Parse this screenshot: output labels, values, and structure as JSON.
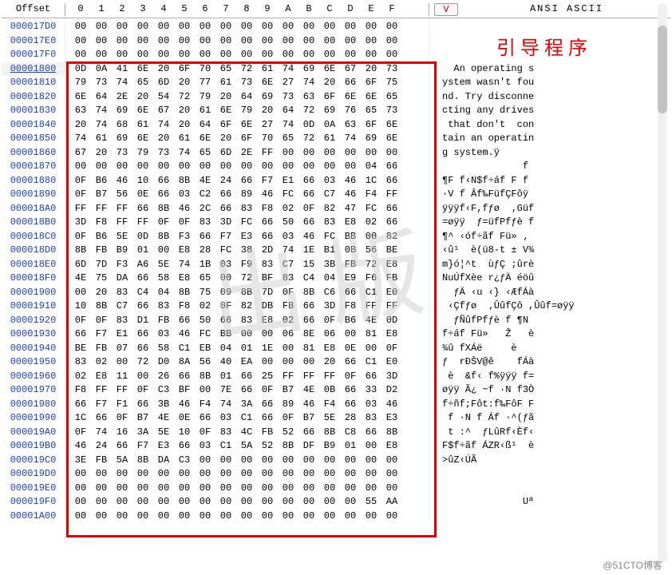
{
  "header": {
    "offset_label": "Offset",
    "hex_cols": [
      "0",
      "1",
      "2",
      "3",
      "4",
      "5",
      "6",
      "7",
      "8",
      "9",
      "A",
      "B",
      "C",
      "D",
      "E",
      "F"
    ],
    "v_button": "V",
    "ascii_label": "ANSI ASCII"
  },
  "annotation": "引导程序",
  "watermark_cn": "出版",
  "watermark_br": "@51CTO博客",
  "selected_offset": "00001800",
  "rows": [
    {
      "offset": "000017D0",
      "hex": [
        "00",
        "00",
        "00",
        "00",
        "00",
        "00",
        "00",
        "00",
        "00",
        "00",
        "00",
        "00",
        "00",
        "00",
        "00",
        "00"
      ],
      "ascii": ""
    },
    {
      "offset": "000017E0",
      "hex": [
        "00",
        "00",
        "00",
        "00",
        "00",
        "00",
        "00",
        "00",
        "00",
        "00",
        "00",
        "00",
        "00",
        "00",
        "00",
        "00"
      ],
      "ascii": ""
    },
    {
      "offset": "000017F0",
      "hex": [
        "00",
        "00",
        "00",
        "00",
        "00",
        "00",
        "00",
        "00",
        "00",
        "00",
        "00",
        "00",
        "00",
        "00",
        "00",
        "00"
      ],
      "ascii": ""
    },
    {
      "offset": "00001800",
      "hex": [
        "0D",
        "0A",
        "41",
        "6E",
        "20",
        "6F",
        "70",
        "65",
        "72",
        "61",
        "74",
        "69",
        "6E",
        "67",
        "20",
        "73"
      ],
      "ascii": "  An operating s"
    },
    {
      "offset": "00001810",
      "hex": [
        "79",
        "73",
        "74",
        "65",
        "6D",
        "20",
        "77",
        "61",
        "73",
        "6E",
        "27",
        "74",
        "20",
        "66",
        "6F",
        "75"
      ],
      "ascii": "ystem wasn't fou"
    },
    {
      "offset": "00001820",
      "hex": [
        "6E",
        "64",
        "2E",
        "20",
        "54",
        "72",
        "79",
        "20",
        "64",
        "69",
        "73",
        "63",
        "6F",
        "6E",
        "6E",
        "65"
      ],
      "ascii": "nd. Try disconne"
    },
    {
      "offset": "00001830",
      "hex": [
        "63",
        "74",
        "69",
        "6E",
        "67",
        "20",
        "61",
        "6E",
        "79",
        "20",
        "64",
        "72",
        "69",
        "76",
        "65",
        "73"
      ],
      "ascii": "cting any drives"
    },
    {
      "offset": "00001840",
      "hex": [
        "20",
        "74",
        "68",
        "61",
        "74",
        "20",
        "64",
        "6F",
        "6E",
        "27",
        "74",
        "0D",
        "0A",
        "63",
        "6F",
        "6E"
      ],
      "ascii": " that don't  con"
    },
    {
      "offset": "00001850",
      "hex": [
        "74",
        "61",
        "69",
        "6E",
        "20",
        "61",
        "6E",
        "20",
        "6F",
        "70",
        "65",
        "72",
        "61",
        "74",
        "69",
        "6E"
      ],
      "ascii": "tain an operatin"
    },
    {
      "offset": "00001860",
      "hex": [
        "67",
        "20",
        "73",
        "79",
        "73",
        "74",
        "65",
        "6D",
        "2E",
        "FF",
        "00",
        "00",
        "00",
        "00",
        "00",
        "00"
      ],
      "ascii": "g system.ÿ"
    },
    {
      "offset": "00001870",
      "hex": [
        "00",
        "00",
        "00",
        "00",
        "00",
        "00",
        "00",
        "00",
        "00",
        "00",
        "00",
        "00",
        "00",
        "00",
        "04",
        "66"
      ],
      "ascii": "              f"
    },
    {
      "offset": "00001880",
      "hex": [
        "0F",
        "B6",
        "46",
        "10",
        "66",
        "8B",
        "4E",
        "24",
        "66",
        "F7",
        "E1",
        "66",
        "03",
        "46",
        "1C",
        "66"
      ],
      "ascii": "¶F f‹N$f÷áf F f"
    },
    {
      "offset": "00001890",
      "hex": [
        "0F",
        "B7",
        "56",
        "0E",
        "66",
        "03",
        "C2",
        "66",
        "89",
        "46",
        "FC",
        "66",
        "C7",
        "46",
        "F4",
        "FF"
      ],
      "ascii": "·V f Âf‰FüfÇFôÿ"
    },
    {
      "offset": "000018A0",
      "hex": [
        "FF",
        "FF",
        "FF",
        "66",
        "8B",
        "46",
        "2C",
        "66",
        "83",
        "F8",
        "02",
        "0F",
        "82",
        "47",
        "FC",
        "66"
      ],
      "ascii": "ÿÿÿf‹F,fƒø  ‚Güf"
    },
    {
      "offset": "000018B0",
      "hex": [
        "3D",
        "F8",
        "FF",
        "FF",
        "0F",
        "0F",
        "83",
        "3D",
        "FC",
        "66",
        "50",
        "66",
        "83",
        "E8",
        "02",
        "66"
      ],
      "ascii": "=øÿÿ  ƒ=üfPfƒè f"
    },
    {
      "offset": "000018C0",
      "hex": [
        "0F",
        "B6",
        "5E",
        "0D",
        "8B",
        "F3",
        "66",
        "F7",
        "E3",
        "66",
        "03",
        "46",
        "FC",
        "BB",
        "00",
        "82"
      ],
      "ascii": "¶^ ‹óf÷ãf Fü» ‚"
    },
    {
      "offset": "000018D0",
      "hex": [
        "8B",
        "FB",
        "B9",
        "01",
        "00",
        "E8",
        "28",
        "FC",
        "38",
        "2D",
        "74",
        "1E",
        "B1",
        "0B",
        "56",
        "BE"
      ],
      "ascii": "‹û¹  è(ü8-t ± V¾"
    },
    {
      "offset": "000018E0",
      "hex": [
        "6D",
        "7D",
        "F3",
        "A6",
        "5E",
        "74",
        "1B",
        "03",
        "F9",
        "83",
        "C7",
        "15",
        "3B",
        "FB",
        "72",
        "E8"
      ],
      "ascii": "m}ó¦^t  ùƒÇ ;ûrè"
    },
    {
      "offset": "000018F0",
      "hex": [
        "4E",
        "75",
        "DA",
        "66",
        "58",
        "E8",
        "65",
        "00",
        "72",
        "BF",
        "83",
        "C4",
        "04",
        "E9",
        "F6",
        "FB"
      ],
      "ascii": "NuÚfXèe r¿ƒÄ éöû"
    },
    {
      "offset": "00001900",
      "hex": [
        "00",
        "20",
        "83",
        "C4",
        "04",
        "8B",
        "75",
        "09",
        "8B",
        "7D",
        "0F",
        "8B",
        "C6",
        "66",
        "C1",
        "E0"
      ],
      "ascii": "  ƒÄ ‹u ‹} ‹ÆfÁà"
    },
    {
      "offset": "00001910",
      "hex": [
        "10",
        "8B",
        "C7",
        "66",
        "83",
        "F8",
        "02",
        "0F",
        "82",
        "DB",
        "FB",
        "66",
        "3D",
        "F8",
        "FF",
        "FF"
      ],
      "ascii": " ‹Çfƒø  ‚ÛûfÇô ,Ûûf=øÿÿ"
    },
    {
      "offset": "00001920",
      "hex": [
        "0F",
        "0F",
        "83",
        "D1",
        "FB",
        "66",
        "50",
        "66",
        "83",
        "E8",
        "02",
        "66",
        "0F",
        "B6",
        "4E",
        "0D"
      ],
      "ascii": "  ƒÑûfPfƒè f ¶N"
    },
    {
      "offset": "00001930",
      "hex": [
        "66",
        "F7",
        "E1",
        "66",
        "03",
        "46",
        "FC",
        "BB",
        "00",
        "00",
        "06",
        "8E",
        "06",
        "00",
        "81",
        "E8"
      ],
      "ascii": "f÷áf Fü»   Ž   è"
    },
    {
      "offset": "00001940",
      "hex": [
        "BE",
        "FB",
        "07",
        "66",
        "58",
        "C1",
        "EB",
        "04",
        "01",
        "1E",
        "00",
        "81",
        "E8",
        "0E",
        "00",
        "0F"
      ],
      "ascii": "¾û fXÁë     è"
    },
    {
      "offset": "00001950",
      "hex": [
        "83",
        "02",
        "00",
        "72",
        "D0",
        "8A",
        "56",
        "40",
        "EA",
        "00",
        "00",
        "00",
        "20",
        "66",
        "C1",
        "E0"
      ],
      "ascii": "ƒ  rÐŠV@ê    fÁà"
    },
    {
      "offset": "00001960",
      "hex": [
        "02",
        "E8",
        "11",
        "00",
        "26",
        "66",
        "8B",
        "01",
        "66",
        "25",
        "FF",
        "FF",
        "FF",
        "0F",
        "66",
        "3D"
      ],
      "ascii": " è  &f‹ f%ÿÿÿ f="
    },
    {
      "offset": "00001970",
      "hex": [
        "F8",
        "FF",
        "FF",
        "0F",
        "C3",
        "BF",
        "00",
        "7E",
        "66",
        "0F",
        "B7",
        "4E",
        "0B",
        "66",
        "33",
        "D2"
      ],
      "ascii": "øÿÿ Ã¿ ~f ·N f3Ò"
    },
    {
      "offset": "00001980",
      "hex": [
        "66",
        "F7",
        "F1",
        "66",
        "3B",
        "46",
        "F4",
        "74",
        "3A",
        "66",
        "89",
        "46",
        "F4",
        "66",
        "03",
        "46"
      ],
      "ascii": "f÷ñf;Fôt:f‰FôF F"
    },
    {
      "offset": "00001990",
      "hex": [
        "1C",
        "66",
        "0F",
        "B7",
        "4E",
        "0E",
        "66",
        "03",
        "C1",
        "66",
        "0F",
        "B7",
        "5E",
        "28",
        "83",
        "E3"
      ],
      "ascii": " f ·N f Áf ·^(ƒã"
    },
    {
      "offset": "000019A0",
      "hex": [
        "0F",
        "74",
        "16",
        "3A",
        "5E",
        "10",
        "0F",
        "83",
        "4C",
        "FB",
        "52",
        "66",
        "8B",
        "C8",
        "66",
        "8B"
      ],
      "ascii": " t :^  ƒLûRf‹Èf‹"
    },
    {
      "offset": "000019B0",
      "hex": [
        "46",
        "24",
        "66",
        "F7",
        "E3",
        "66",
        "03",
        "C1",
        "5A",
        "52",
        "8B",
        "DF",
        "B9",
        "01",
        "00",
        "E8"
      ],
      "ascii": "F$f÷ãf ÁZR‹ß¹  è"
    },
    {
      "offset": "000019C0",
      "hex": [
        "3E",
        "FB",
        "5A",
        "8B",
        "DA",
        "C3",
        "00",
        "00",
        "00",
        "00",
        "00",
        "00",
        "00",
        "00",
        "00",
        "00"
      ],
      "ascii": ">ûZ‹ÚÃ"
    },
    {
      "offset": "000019D0",
      "hex": [
        "00",
        "00",
        "00",
        "00",
        "00",
        "00",
        "00",
        "00",
        "00",
        "00",
        "00",
        "00",
        "00",
        "00",
        "00",
        "00"
      ],
      "ascii": ""
    },
    {
      "offset": "000019E0",
      "hex": [
        "00",
        "00",
        "00",
        "00",
        "00",
        "00",
        "00",
        "00",
        "00",
        "00",
        "00",
        "00",
        "00",
        "00",
        "00",
        "00"
      ],
      "ascii": ""
    },
    {
      "offset": "000019F0",
      "hex": [
        "00",
        "00",
        "00",
        "00",
        "00",
        "00",
        "00",
        "00",
        "00",
        "00",
        "00",
        "00",
        "00",
        "00",
        "55",
        "AA"
      ],
      "ascii": "              Uª"
    },
    {
      "offset": "00001A00",
      "hex": [
        "00",
        "00",
        "00",
        "00",
        "00",
        "00",
        "00",
        "00",
        "00",
        "00",
        "00",
        "00",
        "00",
        "00",
        "00",
        "00"
      ],
      "ascii": ""
    }
  ]
}
